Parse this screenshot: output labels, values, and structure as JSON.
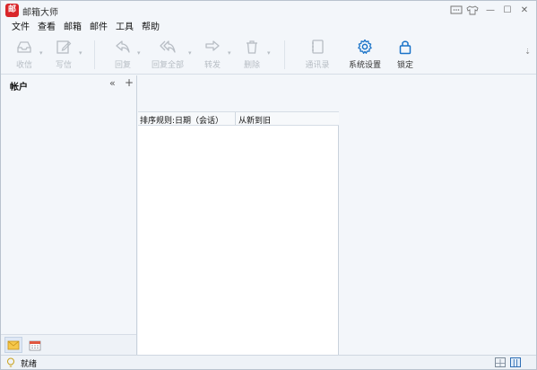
{
  "window": {
    "app_icon_glyph": "邮",
    "title": "邮箱大师",
    "controls": {
      "feedback_icon": "chat-icon",
      "skin_icon": "shirt-icon",
      "minimize_glyph": "—",
      "maximize_glyph": "☐",
      "close_glyph": "✕"
    }
  },
  "menu": {
    "items": [
      "文件",
      "查看",
      "邮箱",
      "邮件",
      "工具",
      "帮助"
    ]
  },
  "toolbar": {
    "buttons": [
      {
        "label": "收信",
        "icon": "inbox-icon",
        "enabled": false
      },
      {
        "label": "写信",
        "icon": "compose-icon",
        "enabled": false
      },
      {
        "label": "回复",
        "icon": "reply-icon",
        "enabled": false
      },
      {
        "label": "回复全部",
        "icon": "reply-all-icon",
        "enabled": false
      },
      {
        "label": "转发",
        "icon": "forward-icon",
        "enabled": false
      },
      {
        "label": "删除",
        "icon": "trash-icon",
        "enabled": false
      },
      {
        "label": "通讯录",
        "icon": "contacts-icon",
        "enabled": false
      },
      {
        "label": "系统设置",
        "icon": "gear-icon",
        "enabled": true
      },
      {
        "label": "锁定",
        "icon": "lock-icon",
        "enabled": true
      }
    ],
    "more_glyph": "⇣"
  },
  "accounts": {
    "title": "帐户",
    "collapse_glyph": "«",
    "add_glyph": "+"
  },
  "list": {
    "sort_rule": "排序规则:日期（会话）",
    "sort_order": "从新到旧"
  },
  "status": {
    "text": "就绪"
  },
  "colors": {
    "accent": "#1a73c8",
    "brand_red": "#d9262a",
    "disabled": "#b7bdc4"
  }
}
